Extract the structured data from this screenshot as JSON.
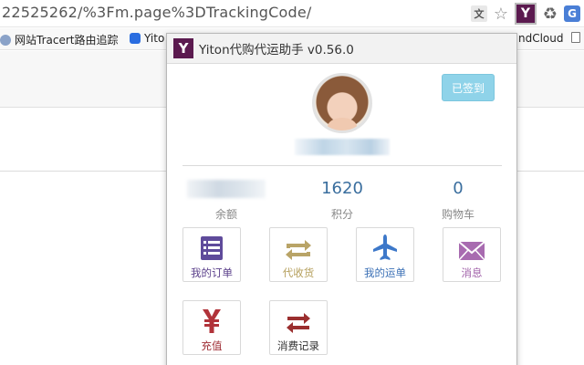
{
  "browser": {
    "url": "22525262/%3Fm.page%3DTrackingCode/",
    "ext_translate_label": "文",
    "ext_star_glyph": "☆",
    "ext_yiton_label": "Y",
    "ext_recycle_glyph": "♻",
    "ext_g_label": "G",
    "bookmarks": [
      {
        "label": "网站Tracert路由追踪"
      },
      {
        "label": "Yito"
      },
      {
        "label": "ndCloud"
      }
    ]
  },
  "popup": {
    "logo_label": "Y",
    "title": "Yiton代购代运助手 v0.56.0",
    "checkin_label": "已签到",
    "stats": {
      "balance_label": "余额",
      "points_value": "1620",
      "points_label": "积分",
      "cart_value": "0",
      "cart_label": "购物车"
    },
    "tiles": [
      {
        "label": "我的订单",
        "icon": "orders-list-icon",
        "color": "#5f4b9b"
      },
      {
        "label": "代收货",
        "icon": "receive-goods-icon",
        "color": "#b9a467"
      },
      {
        "label": "我的运单",
        "icon": "airplane-icon",
        "color": "#3d78c9"
      },
      {
        "label": "消息",
        "icon": "envelope-icon",
        "color": "#a86bb0"
      },
      {
        "label": "充值",
        "icon": "yen-icon",
        "color": "#b1333a"
      },
      {
        "label": "消费记录",
        "icon": "transfer-arrows-icon",
        "color": "#9b2f2f"
      }
    ]
  }
}
